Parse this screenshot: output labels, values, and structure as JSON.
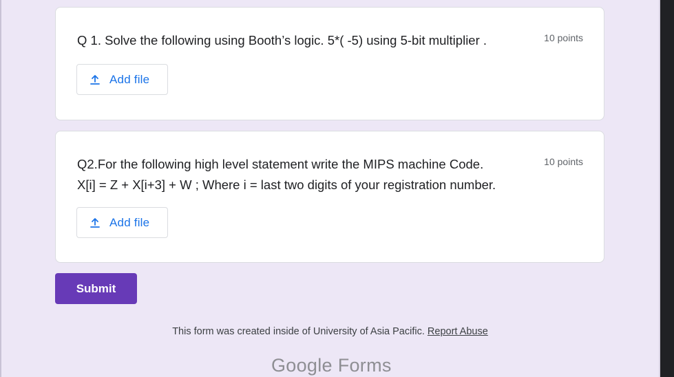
{
  "questions": [
    {
      "title": "Q 1. Solve the following using Booth’s logic. 5*( -5) using 5-bit multiplier .",
      "points": "10 points",
      "add_file_label": "Add file"
    },
    {
      "title_line1": "Q2.For the following high level statement write the MIPS machine Code.",
      "title_line2": "X[i] = Z + X[i+3] + W ; Where i = last two digits of your registration number.",
      "points": "10 points",
      "add_file_label": "Add file"
    }
  ],
  "submit_label": "Submit",
  "footer": {
    "text": "This form was created inside of University of Asia Pacific.",
    "report_link": "Report Abuse"
  },
  "brand": {
    "google": "Google",
    "forms": "Forms"
  },
  "icons": {
    "upload": "upload-icon"
  },
  "colors": {
    "accent": "#673ab7",
    "link": "#1a73e8",
    "background": "#ede7f6"
  }
}
